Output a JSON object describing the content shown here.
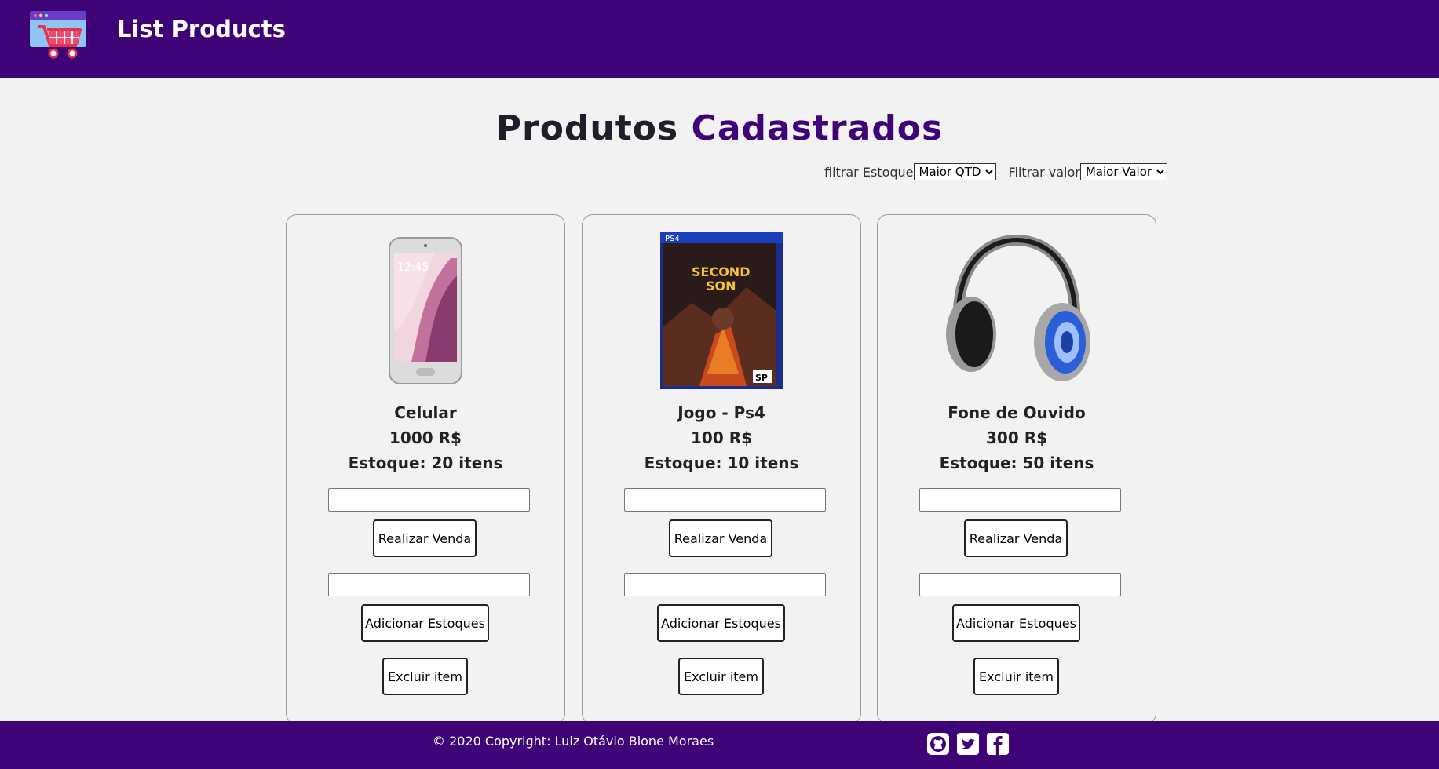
{
  "header": {
    "title": "List Products",
    "logo_icon": "shopping-cart-logo-icon"
  },
  "main": {
    "title_part1": "Produtos",
    "title_part2": "Cadastrados",
    "filters": {
      "stock_label": "filtrar Estoque",
      "stock_selected": "Maior QTD",
      "value_label": "Filtrar valor",
      "value_selected": "Maior Valor"
    }
  },
  "products": [
    {
      "name": "Celular",
      "price": "1000 R$",
      "stock": "Estoque: 20 itens",
      "image": "smartphone-image",
      "sell_label": "Realizar Venda",
      "add_stock_label": "Adicionar Estoques",
      "delete_label": "Excluir item"
    },
    {
      "name": "Jogo - Ps4",
      "price": "100 R$",
      "stock": "Estoque: 10 itens",
      "image": "ps4-game-cover-image",
      "sell_label": "Realizar Venda",
      "add_stock_label": "Adicionar Estoques",
      "delete_label": "Excluir item"
    },
    {
      "name": "Fone de Ouvido",
      "price": "300 R$",
      "stock": "Estoque: 50 itens",
      "image": "headphones-image",
      "sell_label": "Realizar Venda",
      "add_stock_label": "Adicionar Estoques",
      "delete_label": "Excluir item"
    }
  ],
  "footer": {
    "copyright": "© 2020 Copyright: Luiz Otávio Bione Moraes",
    "social_icons": [
      "github-icon",
      "twitter-icon",
      "facebook-icon"
    ]
  },
  "colors": {
    "primary": "#3e0377",
    "background": "#f2f2f2"
  }
}
